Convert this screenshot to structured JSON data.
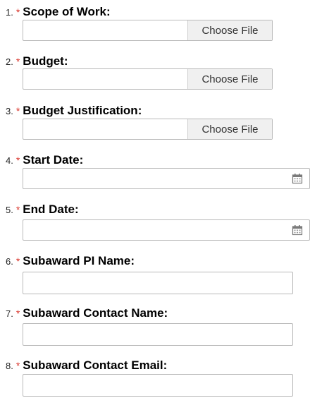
{
  "form": {
    "fields": [
      {
        "number": "1.",
        "required": "*",
        "label": "Scope of Work:",
        "button": "Choose File"
      },
      {
        "number": "2.",
        "required": "*",
        "label": "Budget:",
        "button": "Choose File"
      },
      {
        "number": "3.",
        "required": "*",
        "label": "Budget Justification:",
        "button": "Choose File"
      },
      {
        "number": "4.",
        "required": "*",
        "label": "Start Date:",
        "icon": "calendar-icon",
        "value": ""
      },
      {
        "number": "5.",
        "required": "*",
        "label": "End Date:",
        "icon": "calendar-icon",
        "value": ""
      },
      {
        "number": "6.",
        "required": "*",
        "label": "Subaward PI Name:",
        "value": ""
      },
      {
        "number": "7.",
        "required": "*",
        "label": "Subaward Contact Name:",
        "value": ""
      },
      {
        "number": "8.",
        "required": "*",
        "label": "Subaward Contact Email:",
        "value": ""
      }
    ]
  },
  "colors": {
    "required_star": "#d9342b",
    "border": "#b9b9b9",
    "file_button_bg": "#f0f0f0"
  }
}
